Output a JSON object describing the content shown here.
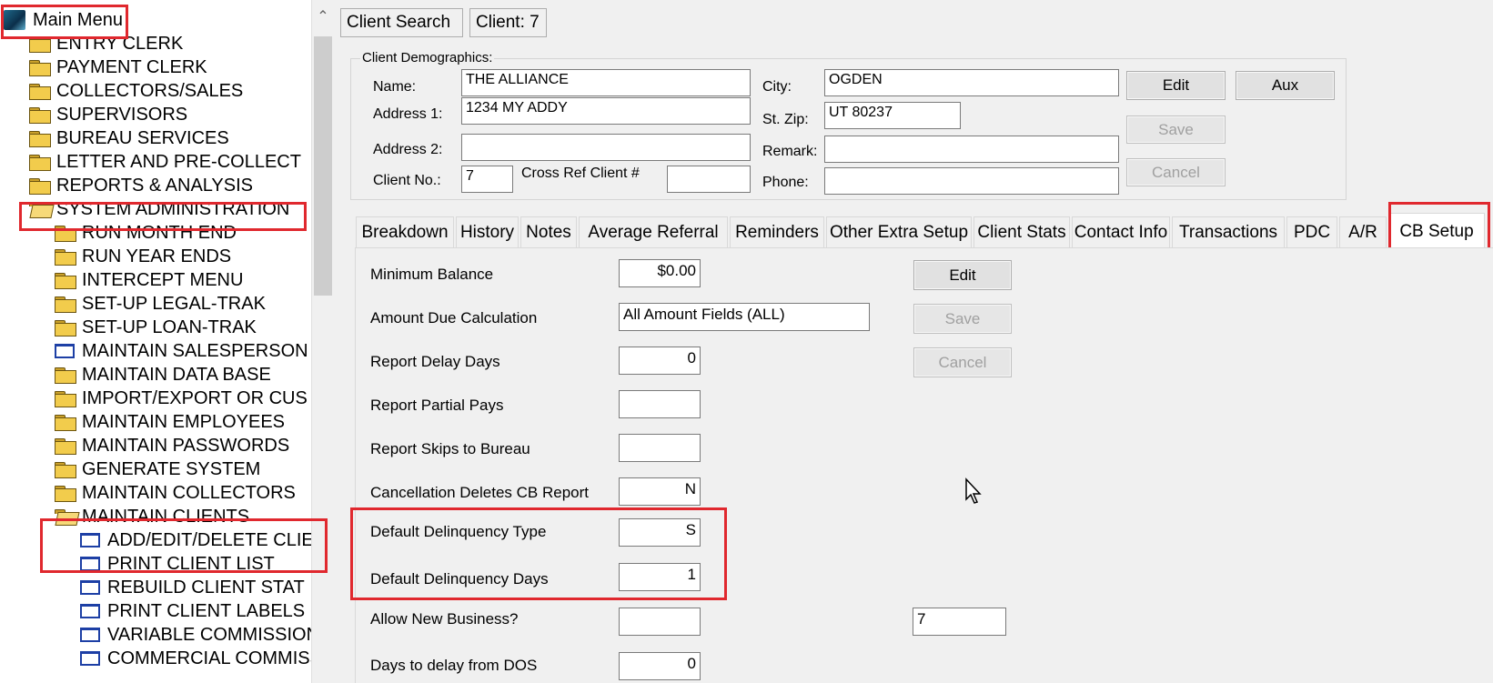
{
  "tree": {
    "items": [
      {
        "label": "Main Menu",
        "icon": "app-icon"
      },
      {
        "label": "ENTRY CLERK",
        "icon": "folder-icon"
      },
      {
        "label": "PAYMENT CLERK",
        "icon": "folder-icon"
      },
      {
        "label": "COLLECTORS/SALES",
        "icon": "folder-icon"
      },
      {
        "label": "SUPERVISORS",
        "icon": "folder-icon"
      },
      {
        "label": "BUREAU SERVICES",
        "icon": "folder-icon"
      },
      {
        "label": "LETTER AND PRE-COLLECT",
        "icon": "folder-icon"
      },
      {
        "label": "REPORTS & ANALYSIS",
        "icon": "folder-icon"
      },
      {
        "label": "SYSTEM ADMINISTRATION",
        "icon": "folder-open-icon"
      },
      {
        "label": "RUN MONTH END",
        "icon": "folder-icon"
      },
      {
        "label": "RUN YEAR ENDS",
        "icon": "folder-icon"
      },
      {
        "label": "INTERCEPT MENU",
        "icon": "folder-icon"
      },
      {
        "label": "SET-UP LEGAL-TRAK",
        "icon": "folder-icon"
      },
      {
        "label": "SET-UP LOAN-TRAK",
        "icon": "folder-icon"
      },
      {
        "label": "MAINTAIN SALESPERSON",
        "icon": "window-icon"
      },
      {
        "label": "MAINTAIN DATA BASE",
        "icon": "folder-icon"
      },
      {
        "label": "IMPORT/EXPORT OR CUS",
        "icon": "folder-icon"
      },
      {
        "label": "MAINTAIN EMPLOYEES",
        "icon": "folder-icon"
      },
      {
        "label": "MAINTAIN PASSWORDS",
        "icon": "folder-icon"
      },
      {
        "label": "GENERATE SYSTEM",
        "icon": "folder-icon"
      },
      {
        "label": "MAINTAIN COLLECTORS",
        "icon": "folder-icon"
      },
      {
        "label": "MAINTAIN CLIENTS",
        "icon": "folder-open-icon"
      },
      {
        "label": "ADD/EDIT/DELETE CLIE",
        "icon": "window-icon"
      },
      {
        "label": "PRINT CLIENT LIST",
        "icon": "window-icon"
      },
      {
        "label": "REBUILD CLIENT STAT",
        "icon": "window-icon"
      },
      {
        "label": "PRINT CLIENT LABELS",
        "icon": "window-icon"
      },
      {
        "label": "VARIABLE COMMISSION",
        "icon": "window-icon"
      },
      {
        "label": "COMMERCIAL COMMISS",
        "icon": "window-icon"
      }
    ]
  },
  "header": {
    "client_search": "Client Search",
    "client_label": "Client: 7"
  },
  "demographics": {
    "title": "Client Demographics:",
    "name_label": "Name:",
    "name": "THE ALLIANCE",
    "address1_label": "Address 1:",
    "address1": "1234 MY ADDY",
    "address2_label": "Address 2:",
    "address2": "",
    "client_no_label": "Client No.:",
    "client_no": "7",
    "cross_ref_label": "Cross Ref Client #",
    "cross_ref": "",
    "city_label": "City:",
    "city": "OGDEN",
    "stzip_label": "St. Zip:",
    "stzip": "UT 80237",
    "remark_label": "Remark:",
    "remark": "",
    "phone_label": "Phone:",
    "phone": "",
    "edit": "Edit",
    "aux": "Aux",
    "save": "Save",
    "cancel": "Cancel"
  },
  "tabs": [
    "Breakdown",
    "History",
    "Notes",
    "Average Referral",
    "Reminders",
    "Other Extra Setup",
    "Client Stats",
    "Contact Info",
    "Transactions",
    "PDC",
    "A/R",
    "CB Setup"
  ],
  "cb_setup": {
    "min_balance_label": "Minimum Balance",
    "min_balance": "$0.00",
    "amount_due_label": "Amount Due Calculation",
    "amount_due": "All Amount Fields (ALL)",
    "report_delay_label": "Report Delay Days",
    "report_delay": "0",
    "partial_pays_label": "Report Partial Pays",
    "partial_pays": "",
    "skips_label": "Report Skips to Bureau",
    "skips": "",
    "cancel_deletes_label": "Cancellation Deletes CB Report",
    "cancel_deletes": "N",
    "delinq_type_label": "Default Delinquency Type",
    "delinq_type": "S",
    "delinq_days_label": "Default Delinquency Days",
    "delinq_days": "1",
    "allow_new_label": "Allow New Business?",
    "allow_new": "",
    "allow_new_extra": "7",
    "days_delay_label": "Days to delay from DOS",
    "days_delay": "0",
    "edit": "Edit",
    "save": "Save",
    "cancel": "Cancel"
  },
  "colors": {
    "highlight": "#e0282e",
    "selected_bg": "#ffffff"
  }
}
